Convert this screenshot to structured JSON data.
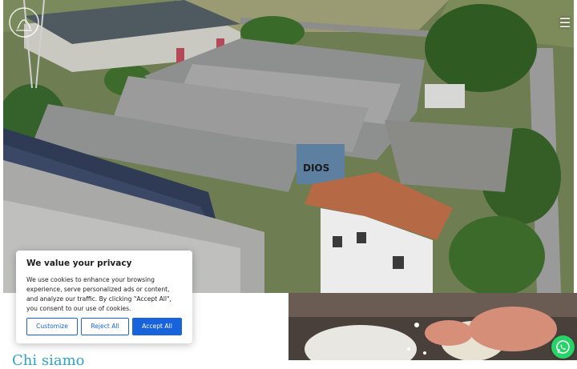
{
  "header": {
    "logo_icon": "company-logo",
    "menu_icon": "hamburger-menu-icon"
  },
  "hero": {
    "mural_text": "DIOS"
  },
  "about": {
    "title": "Chi siamo"
  },
  "cookie_banner": {
    "title": "We value your privacy",
    "text": "We use cookies to enhance your browsing experience, serve personalized ads or content, and analyze our traffic. By clicking \"Accept All\", you consent to our use of cookies.",
    "customize_label": "Customize",
    "reject_label": "Reject All",
    "accept_label": "Accept All",
    "accent_color": "#1863dc"
  },
  "whatsapp": {
    "icon": "whatsapp-icon",
    "color": "#25d366"
  },
  "colors": {
    "title_color": "#2ea3c9"
  }
}
